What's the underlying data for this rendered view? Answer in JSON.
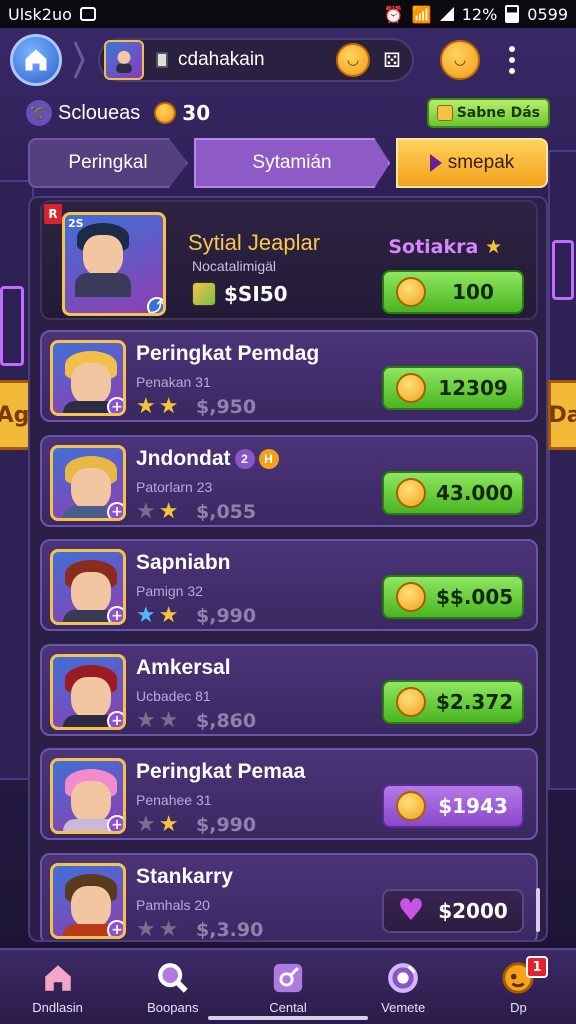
{
  "status_bar": {
    "carrier": "Ulsk2uo",
    "battery": "12%",
    "time": "0599"
  },
  "header": {
    "profile_name": "cdahakain"
  },
  "score_row": {
    "label": "Scloueas",
    "value": "30",
    "button_label": "Sabne Dás"
  },
  "tabs": [
    {
      "label": "Peringkal"
    },
    {
      "label": "Sytamián"
    },
    {
      "label": "smepak"
    }
  ],
  "top_entry": {
    "rank_badge": "R",
    "avatar_badge": "2S",
    "name": "Sytial Jeaplar",
    "subtitle": "Nocatalimigäl",
    "cash": "$SI50",
    "right_name": "Sotiakra",
    "action_value": "100"
  },
  "entries": [
    {
      "name": "Peringkat Pemdag",
      "subtitle": "Penakan 31",
      "price": "$,950",
      "action_value": "12309",
      "stars": [
        "gold",
        "gold"
      ],
      "action_style": "green",
      "hair": "#f2c048",
      "body": "#2c2c44"
    },
    {
      "name": "Jndondat",
      "name_badges": [
        "2",
        "H"
      ],
      "subtitle": "Patorlarn 23",
      "price": "$,055",
      "action_value": "43.000",
      "stars": [
        "grey",
        "gold"
      ],
      "action_style": "green",
      "hair": "#e7b844",
      "body": "#4a5d8e"
    },
    {
      "name": "Sapniabn",
      "subtitle": "Pamign 32",
      "price": "$,990",
      "action_value": "$$.005",
      "stars": [
        "blue",
        "gold"
      ],
      "action_style": "green",
      "hair": "#8b2b1e",
      "body": "#3a3a56"
    },
    {
      "name": "Amkersal",
      "subtitle": "Ucbadec 81",
      "price": "$,860",
      "action_value": "$2.372",
      "stars": [
        "grey",
        "grey"
      ],
      "action_style": "green",
      "hair": "#9a1c22",
      "body": "#2e2a44"
    },
    {
      "name": "Peringkat Pemaa",
      "subtitle": "Penahee 31",
      "price": "$,990",
      "action_value": "$1943",
      "stars": [
        "grey",
        "gold"
      ],
      "action_style": "purple",
      "hair": "#f08ccc",
      "body": "#c9b8d8"
    },
    {
      "name": "Stankarry",
      "subtitle": "Pamhals 20",
      "price": "$,3.90",
      "action_value": "$2000",
      "stars": [
        "grey",
        "grey"
      ],
      "action_style": "dark",
      "hair": "#5a3a1c",
      "body": "#b83a1a"
    }
  ],
  "bottom_nav": [
    {
      "label": "Dndlasin",
      "icon": "home-icon"
    },
    {
      "label": "Boopans",
      "icon": "search-icon"
    },
    {
      "label": "Cental",
      "icon": "edit-icon"
    },
    {
      "label": "Vemete",
      "icon": "target-icon"
    },
    {
      "label": "Dp",
      "icon": "face-icon",
      "badge": "1"
    }
  ],
  "colors": {
    "accent_green": "#6cc630",
    "accent_purple": "#8e5ac6",
    "accent_orange": "#f2a11d",
    "gold": "#f3c53a"
  }
}
